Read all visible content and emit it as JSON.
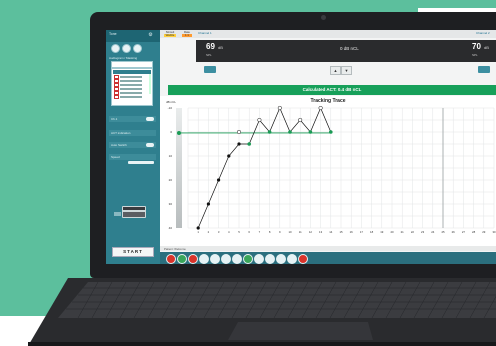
{
  "left_panel": {
    "header_label": "Tone",
    "protocol_label": "Audiogram / Masking",
    "list_items": [
      "",
      "",
      "",
      "",
      "",
      ""
    ],
    "row_labels": [
      "Ch.1",
      "ACT indication",
      "Auto Switch",
      "Speed"
    ],
    "start_label": "START"
  },
  "top": {
    "tab_left": "Stimuli",
    "tab_left_value": "Warble",
    "tab_right": "Rate",
    "tab_right_value": "1:1",
    "channel1_label": "Channel 1",
    "channel2_label": "Channel 2",
    "left_level": "69",
    "left_unit": "dB",
    "left_sub": "SPL",
    "center_level": "0 dB nCL",
    "right_level": "70",
    "right_unit": "dB",
    "right_sub": "SPL"
  },
  "banner": "Calculated ACT: 0.4 dB nCL",
  "status_text": "Patient: Welcome",
  "toolbar_icons": [
    "stop-icon",
    "tone-icon",
    "record-icon",
    "pause-icon",
    "save-icon",
    "print-icon",
    "report-icon",
    "ear-icon",
    "chart-icon",
    "home-icon",
    "user-icon",
    "settings-icon",
    "close-icon"
  ],
  "colors": {
    "accent_teal": "#2f7f8e",
    "banner_green": "#17a05a",
    "trace_black": "#111111",
    "trace_green": "#1a9b55",
    "background_teal": "#5cbf9d"
  },
  "chart_data": {
    "type": "line",
    "title": "Tracking Trace",
    "ylabel": "dB nCL",
    "y_ticks": [
      "-10",
      "0",
      "10",
      "20",
      "30",
      "40"
    ],
    "x_ticks": [
      "1",
      "2",
      "3",
      "4",
      "5",
      "6",
      "7",
      "8",
      "9",
      "10",
      "11",
      "12",
      "13",
      "14",
      "15",
      "16",
      "17",
      "18",
      "19",
      "20",
      "21",
      "22",
      "23",
      "24",
      "25",
      "26",
      "27",
      "28",
      "29",
      "30"
    ],
    "ylim": [
      -10,
      40
    ],
    "xlim": [
      0,
      30
    ],
    "act_line_value": 0.4,
    "series": [
      {
        "style": "filled-black",
        "x": [
          1,
          2,
          3,
          4,
          5
        ],
        "y": [
          40,
          30,
          20,
          10,
          5
        ]
      },
      {
        "style": "open",
        "x": [
          5,
          7,
          9,
          11,
          13
        ],
        "y": [
          0,
          -5,
          -10,
          -5,
          -10
        ]
      },
      {
        "style": "filled-green",
        "x": [
          6,
          8,
          10,
          12,
          14
        ],
        "y": [
          5,
          0,
          0,
          0,
          0
        ]
      }
    ],
    "grid": true
  }
}
